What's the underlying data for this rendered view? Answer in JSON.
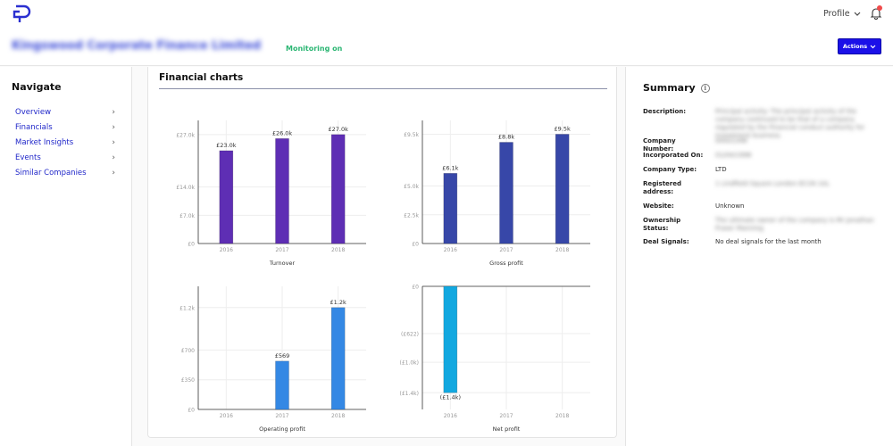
{
  "header": {
    "company_name": "Kingswood Corporate Finance Limited",
    "monitoring": "Monitoring on",
    "profile_label": "Profile",
    "actions_label": "Actions"
  },
  "nav": {
    "title": "Navigate",
    "items": [
      "Overview",
      "Financials",
      "Market Insights",
      "Events",
      "Similar Companies"
    ]
  },
  "financial": {
    "title": "Financial charts"
  },
  "chart_data": [
    {
      "type": "bar",
      "xlabel": "Turnover",
      "categories": [
        "2016",
        "2017",
        "2018"
      ],
      "values": [
        23000,
        26000,
        27000
      ],
      "data_labels": [
        "£23.0k",
        "£26.0k",
        "£27.0k"
      ],
      "yticks": [
        0,
        7000,
        14000,
        27000
      ],
      "ytick_labels": [
        "£0",
        "£7.0k",
        "£14.0k",
        "£27.0k"
      ],
      "ylim": [
        0,
        30500
      ],
      "color": "#5e2eb4"
    },
    {
      "type": "bar",
      "xlabel": "Gross profit",
      "categories": [
        "2016",
        "2017",
        "2018"
      ],
      "values": [
        6100,
        8800,
        9500
      ],
      "data_labels": [
        "£6.1k",
        "£8.8k",
        "£9.5k"
      ],
      "yticks": [
        0,
        2500,
        5000,
        9500
      ],
      "ytick_labels": [
        "£0",
        "£2.5k",
        "£5.0k",
        "£9.5k"
      ],
      "ylim": [
        0,
        10700
      ],
      "color": "#3747a8"
    },
    {
      "type": "bar",
      "xlabel": "Operating profit",
      "categories": [
        "2016",
        "2017",
        "2018"
      ],
      "values": [
        0,
        569,
        1200
      ],
      "data_labels": [
        "",
        "£569",
        "£1.2k"
      ],
      "yticks": [
        0,
        350,
        700,
        1200
      ],
      "ytick_labels": [
        "£0",
        "£350",
        "£700",
        "£1.2k"
      ],
      "ylim": [
        0,
        1450
      ],
      "color": "#3488e4"
    },
    {
      "type": "bar",
      "xlabel": "Net profit",
      "categories": [
        "2016",
        "2017",
        "2018"
      ],
      "values": [
        -1400,
        0,
        0
      ],
      "data_labels": [
        "(£1.4k)",
        "",
        ""
      ],
      "yticks": [
        0,
        -622,
        -1000,
        -1400
      ],
      "ytick_labels": [
        "£0",
        "(£622)",
        "(£1.0k)",
        "(£1.4k)"
      ],
      "ylim": [
        -1620,
        0
      ],
      "color": "#12a8e0"
    }
  ],
  "summary": {
    "title": "Summary",
    "rows": [
      {
        "label": "Description:",
        "value": "Principal activity: The principal activity of the company continued to be that of a company regulated by the Financial conduct authority for investment business.",
        "blurred": true
      },
      {
        "label": "Company Number:",
        "value": "00421348",
        "blurred": true
      },
      {
        "label": "Incorporated On:",
        "value": "01/04/1998",
        "blurred": true
      },
      {
        "label": "Company Type:",
        "value": "LTD",
        "blurred": false
      },
      {
        "label": "Registered address:",
        "value": "1 Lindfield Square London EC1N 1AL",
        "blurred": true
      },
      {
        "label": "Website:",
        "value": "Unknown",
        "blurred": false
      },
      {
        "label": "Ownership Status:",
        "value": "The ultimate owner of the company is Mr Jonathan Fraser Manning",
        "blurred": true
      },
      {
        "label": "Deal Signals:",
        "value": "No deal signals for the last month",
        "blurred": false
      }
    ]
  }
}
